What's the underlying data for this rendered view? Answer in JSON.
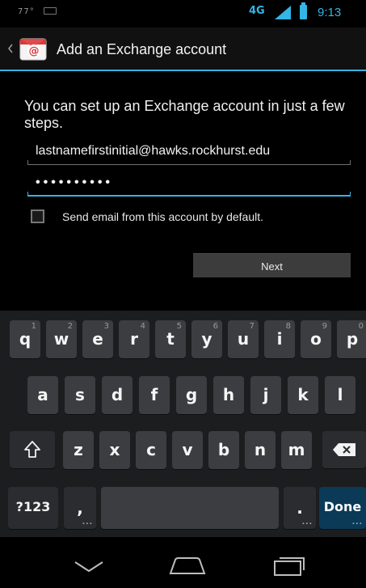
{
  "status_bar": {
    "left_text": "77°",
    "network": "4G",
    "time": "9:13"
  },
  "action_bar": {
    "title": "Add an Exchange account"
  },
  "form": {
    "intro": "You can set up an Exchange account in just a few steps.",
    "email_value": "lastnamefirstinitial@hawks.rockhurst.edu",
    "password_value": "••••••••••",
    "default_checkbox_label": "Send email from this account by default.",
    "default_checked": false,
    "next_label": "Next"
  },
  "keyboard": {
    "row1": [
      {
        "l": "q",
        "h": "1"
      },
      {
        "l": "w",
        "h": "2"
      },
      {
        "l": "e",
        "h": "3"
      },
      {
        "l": "r",
        "h": "4"
      },
      {
        "l": "t",
        "h": "5"
      },
      {
        "l": "y",
        "h": "6"
      },
      {
        "l": "u",
        "h": "7"
      },
      {
        "l": "i",
        "h": "8"
      },
      {
        "l": "o",
        "h": "9"
      },
      {
        "l": "p",
        "h": "0"
      }
    ],
    "row2": [
      "a",
      "s",
      "d",
      "f",
      "g",
      "h",
      "j",
      "k",
      "l"
    ],
    "row3": [
      "z",
      "x",
      "c",
      "v",
      "b",
      "n",
      "m"
    ],
    "symbols_label": "?123",
    "comma_label": ",",
    "period_label": ".",
    "done_label": "Done",
    "more_indicator": "..."
  },
  "icons": {
    "back": "chevron-left-icon",
    "app": "email-app-icon",
    "shift": "shift-icon",
    "delete": "backspace-icon",
    "nav_back": "back-nav-icon",
    "nav_home": "home-nav-icon",
    "nav_recents": "recents-nav-icon"
  },
  "colors": {
    "accent": "#33b5e5",
    "done_key": "#0b3a57"
  }
}
